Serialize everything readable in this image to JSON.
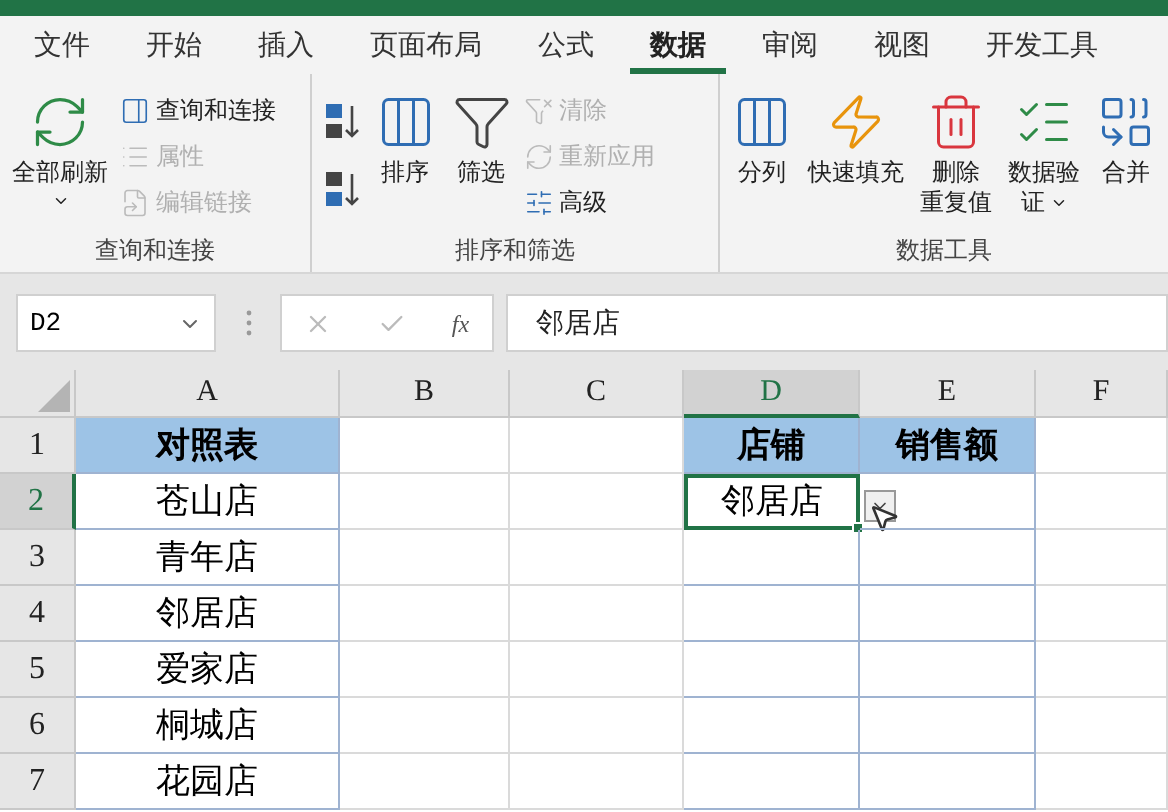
{
  "tabs": [
    {
      "label": "文件",
      "selected": false
    },
    {
      "label": "开始",
      "selected": false
    },
    {
      "label": "插入",
      "selected": false
    },
    {
      "label": "页面布局",
      "selected": false
    },
    {
      "label": "公式",
      "selected": false
    },
    {
      "label": "数据",
      "selected": true
    },
    {
      "label": "审阅",
      "selected": false
    },
    {
      "label": "视图",
      "selected": false
    },
    {
      "label": "开发工具",
      "selected": false
    }
  ],
  "ribbon": {
    "groups": [
      {
        "label": "查询和连接",
        "items": [
          {
            "kind": "large",
            "lines": [
              "全部刷新"
            ],
            "dropdown": true,
            "disabled": false
          },
          {
            "kind": "stack",
            "items": [
              {
                "label": "查询和连接",
                "disabled": false
              },
              {
                "label": "属性",
                "disabled": true
              },
              {
                "label": "编辑链接",
                "disabled": true
              }
            ]
          }
        ]
      },
      {
        "label": "排序和筛选",
        "items": [
          {
            "kind": "sort_icons"
          },
          {
            "kind": "large",
            "lines": [
              "排序"
            ],
            "dropdown": false,
            "disabled": false
          },
          {
            "kind": "large",
            "lines": [
              "筛选"
            ],
            "dropdown": false,
            "disabled": false
          },
          {
            "kind": "stack",
            "items": [
              {
                "label": "清除",
                "disabled": true
              },
              {
                "label": "重新应用",
                "disabled": true
              },
              {
                "label": "高级",
                "disabled": false
              }
            ]
          }
        ]
      },
      {
        "label": "数据工具",
        "items": [
          {
            "kind": "large",
            "lines": [
              "分列"
            ],
            "dropdown": false,
            "disabled": false
          },
          {
            "kind": "large",
            "lines": [
              "快速填充"
            ],
            "dropdown": false,
            "disabled": false
          },
          {
            "kind": "large",
            "lines": [
              "删除",
              "重复值"
            ],
            "dropdown": false,
            "disabled": false
          },
          {
            "kind": "large",
            "lines": [
              "数据验",
              "证"
            ],
            "dropdown": true,
            "disabled": false
          },
          {
            "kind": "large",
            "lines": [
              "合并"
            ],
            "dropdown": false,
            "disabled": false
          }
        ]
      }
    ]
  },
  "formula_bar": {
    "name_box": "D2",
    "function_label": "fx",
    "value": "邻居店"
  },
  "sheet": {
    "columns": [
      {
        "label": "A",
        "selected": false
      },
      {
        "label": "B",
        "selected": false
      },
      {
        "label": "C",
        "selected": false
      },
      {
        "label": "D",
        "selected": true
      },
      {
        "label": "E",
        "selected": false
      },
      {
        "label": "F",
        "selected": false
      }
    ],
    "rows": [
      {
        "label": "1",
        "selected": false,
        "cells": [
          {
            "text": "对照表",
            "fill": true,
            "bold": true
          },
          null,
          null,
          {
            "text": "店铺",
            "fill": true,
            "bold": true
          },
          {
            "text": "销售额",
            "fill": true,
            "bold": true
          },
          null
        ]
      },
      {
        "label": "2",
        "selected": true,
        "cells": [
          {
            "text": "苍山店",
            "fill": false
          },
          null,
          null,
          {
            "text": "邻居店",
            "fill": false,
            "selected": true
          },
          {
            "fill": false
          },
          null
        ]
      },
      {
        "label": "3",
        "selected": false,
        "cells": [
          {
            "text": "青年店",
            "fill": false
          },
          null,
          null,
          {
            "fill": false
          },
          {
            "fill": false
          },
          null
        ]
      },
      {
        "label": "4",
        "selected": false,
        "cells": [
          {
            "text": "邻居店",
            "fill": false
          },
          null,
          null,
          {
            "fill": false
          },
          {
            "fill": false
          },
          null
        ]
      },
      {
        "label": "5",
        "selected": false,
        "cells": [
          {
            "text": "爱家店",
            "fill": false
          },
          null,
          null,
          {
            "fill": false
          },
          {
            "fill": false
          },
          null
        ]
      },
      {
        "label": "6",
        "selected": false,
        "cells": [
          {
            "text": "桐城店",
            "fill": false
          },
          null,
          null,
          {
            "fill": false
          },
          {
            "fill": false
          },
          null
        ]
      },
      {
        "label": "7",
        "selected": false,
        "cells": [
          {
            "text": "花园店",
            "fill": false
          },
          null,
          null,
          {
            "fill": false
          },
          {
            "fill": false
          },
          null
        ]
      }
    ]
  }
}
